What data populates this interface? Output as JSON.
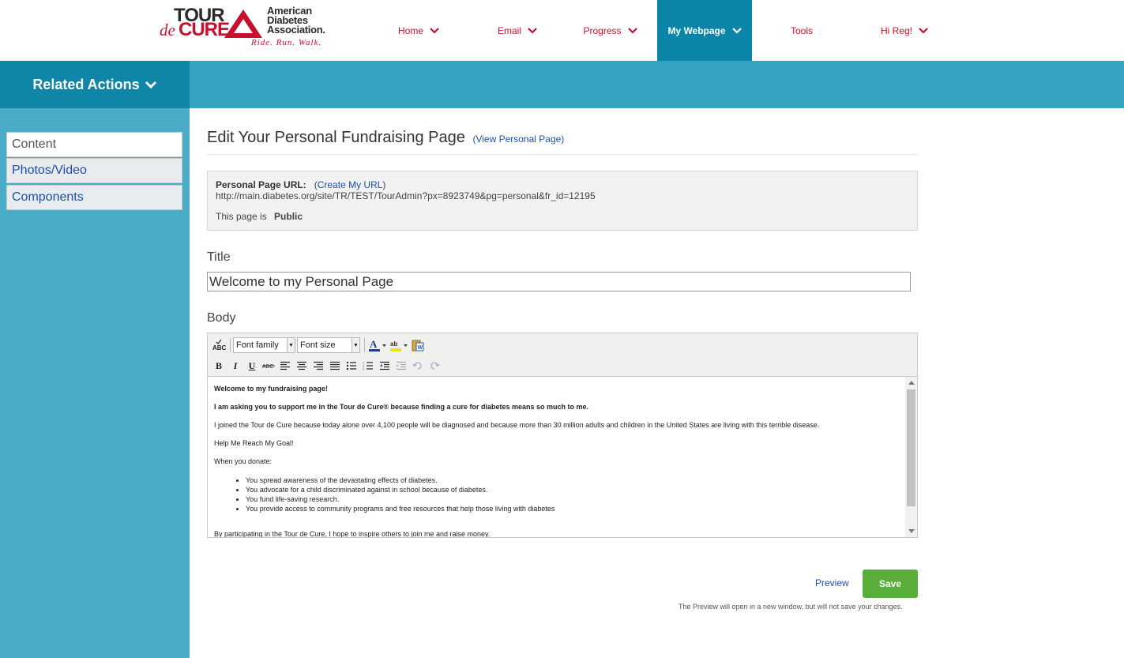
{
  "brand": {
    "tour": "TOUR",
    "de": "de",
    "cure": "CURE",
    "association_lines": [
      "American",
      "Diabetes",
      "Association."
    ],
    "tagline": "Ride. Run. Walk."
  },
  "nav": {
    "items": [
      {
        "label": "Home",
        "has_dropdown": true
      },
      {
        "label": "Email",
        "has_dropdown": true
      },
      {
        "label": "Progress",
        "has_dropdown": true
      },
      {
        "label": "My Webpage",
        "has_dropdown": true,
        "active": true
      },
      {
        "label": "Tools",
        "has_dropdown": false
      },
      {
        "label": "Hi Reg!",
        "has_dropdown": true
      }
    ]
  },
  "related_actions": {
    "label": "Related Actions"
  },
  "sidebar": {
    "items": [
      {
        "label": "Content",
        "active": true
      },
      {
        "label": "Photos/Video",
        "active": false
      },
      {
        "label": "Components",
        "active": false
      }
    ]
  },
  "page": {
    "title": "Edit Your Personal Fundraising Page",
    "view_link": "(View Personal Page)"
  },
  "personal_url": {
    "label": "Personal Page URL:",
    "create_prefix": "(",
    "create_link": "Create My URL",
    "create_suffix": ")",
    "url": "http://main.diabetes.org/site/TR/TEST/TourAdmin?px=8923749&pg=personal&fr_id=12195",
    "status_prefix": "This page is",
    "status_value": "Public"
  },
  "title_field": {
    "label": "Title",
    "value": "Welcome to my Personal Page"
  },
  "body_field": {
    "label": "Body",
    "toolbar": {
      "font_family": "Font family",
      "font_size": "Font size"
    },
    "content": {
      "heading": "Welcome to my fundraising page!",
      "intro_bold": "I am asking you to support me in the Tour de Cure® because finding a cure for diabetes means so much to me.",
      "para1": "I joined the Tour de Cure because today alone over 4,100 people will be diagnosed and because more than 30 million adults and children in the United States are living with this terrible disease.",
      "para2": "Help Me Reach My Goal!",
      "para3": "When you donate:",
      "bullets": [
        "You spread awareness of the devastating effects of diabetes.",
        "You advocate for a child discriminated against in school because of diabetes.",
        "You fund life-saving research.",
        "You provide access to community programs and free resources that help those living with diabetes"
      ],
      "para4": "By participating in the Tour de Cure, I hope to inspire others to join me and raise money."
    }
  },
  "actions": {
    "preview": "Preview",
    "save": "Save",
    "note": "The Preview will open in a new window, but will not save your changes."
  },
  "colors": {
    "nav_text": "#c8102e",
    "nav_active_bg": "#0c86a8",
    "subbar": "#36a3c1",
    "sidebar": "#4aabc6",
    "save": "#5aad3b",
    "link": "#1e4fa8"
  }
}
